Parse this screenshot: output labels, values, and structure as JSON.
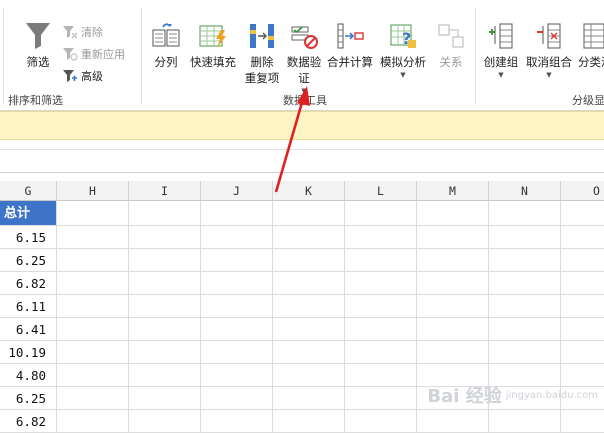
{
  "ribbon": {
    "sort_filter": {
      "filter_label": "筛选",
      "clear_label": "清除",
      "reapply_label": "重新应用",
      "advanced_label": "高级",
      "group_label": "排序和筛选"
    },
    "data_tools": {
      "split_label": "分列",
      "flash_fill_label": "快速填充",
      "remove_dup_line1": "删除",
      "remove_dup_line2": "重复项",
      "validation_line1": "数据验",
      "validation_line2": "证",
      "consolidate_label": "合并计算",
      "whatif_label": "模拟分析",
      "relations_label": "关系",
      "group_label": "数据工具"
    },
    "outline": {
      "group_label": "创建组",
      "ungroup_label": "取消组合",
      "subtotal_label": "分类汇",
      "outline_group_label": "分级显"
    }
  },
  "grid": {
    "columns": [
      "G",
      "H",
      "I",
      "J",
      "K",
      "L",
      "M",
      "N",
      "O"
    ],
    "g_header": "总计",
    "g_values": [
      "6.15",
      "6.25",
      "6.82",
      "6.11",
      "6.41",
      "10.19",
      "4.80",
      "6.25",
      "6.82"
    ]
  },
  "watermark": {
    "text": "Bai 经验",
    "sub": "jingyan.baidu.com"
  },
  "colors": {
    "header_blue": "#3e74c8",
    "info_bar": "#fcf4c3",
    "arrow_red": "#e02020"
  }
}
